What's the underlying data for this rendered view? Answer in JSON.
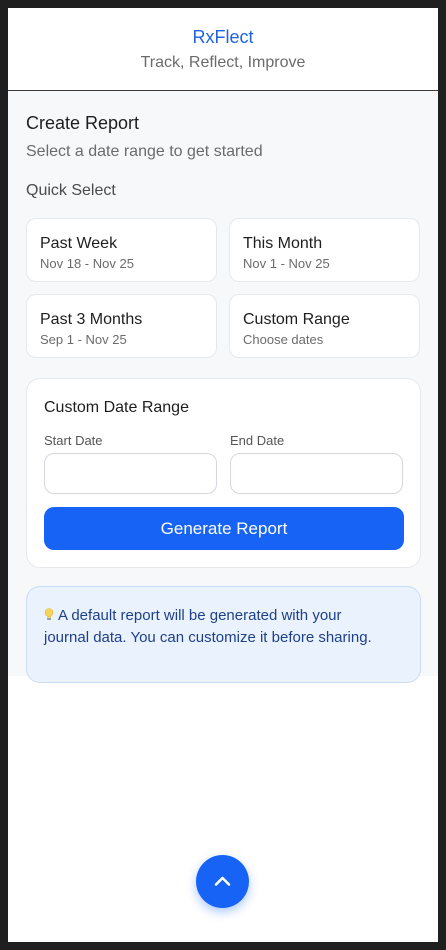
{
  "header": {
    "app_title": "RxFlect",
    "tagline": "Track, Reflect, Improve"
  },
  "report": {
    "title": "Create Report",
    "subtitle": "Select a date range to get started",
    "quick_select_label": "Quick Select",
    "options": [
      {
        "label": "Past Week",
        "range": "Nov 18 - Nov 25"
      },
      {
        "label": "This Month",
        "range": "Nov 1 - Nov 25"
      },
      {
        "label": "Past 3 Months",
        "range": "Sep 1 - Nov 25"
      },
      {
        "label": "Custom Range",
        "range": "Choose dates"
      }
    ]
  },
  "custom_range": {
    "title": "Custom Date Range",
    "start_label": "Start Date",
    "start_value": "",
    "end_label": "End Date",
    "end_value": "",
    "generate_label": "Generate Report"
  },
  "info": {
    "icon": "lightbulb-icon",
    "text": "A default report will be generated with your journal data. You can customize it before sharing."
  },
  "scroll_top": {
    "icon": "chevron-up-icon"
  },
  "colors": {
    "accent": "#1763f5",
    "info_bg": "#eaf3fd",
    "info_text": "#1e3f8a"
  }
}
